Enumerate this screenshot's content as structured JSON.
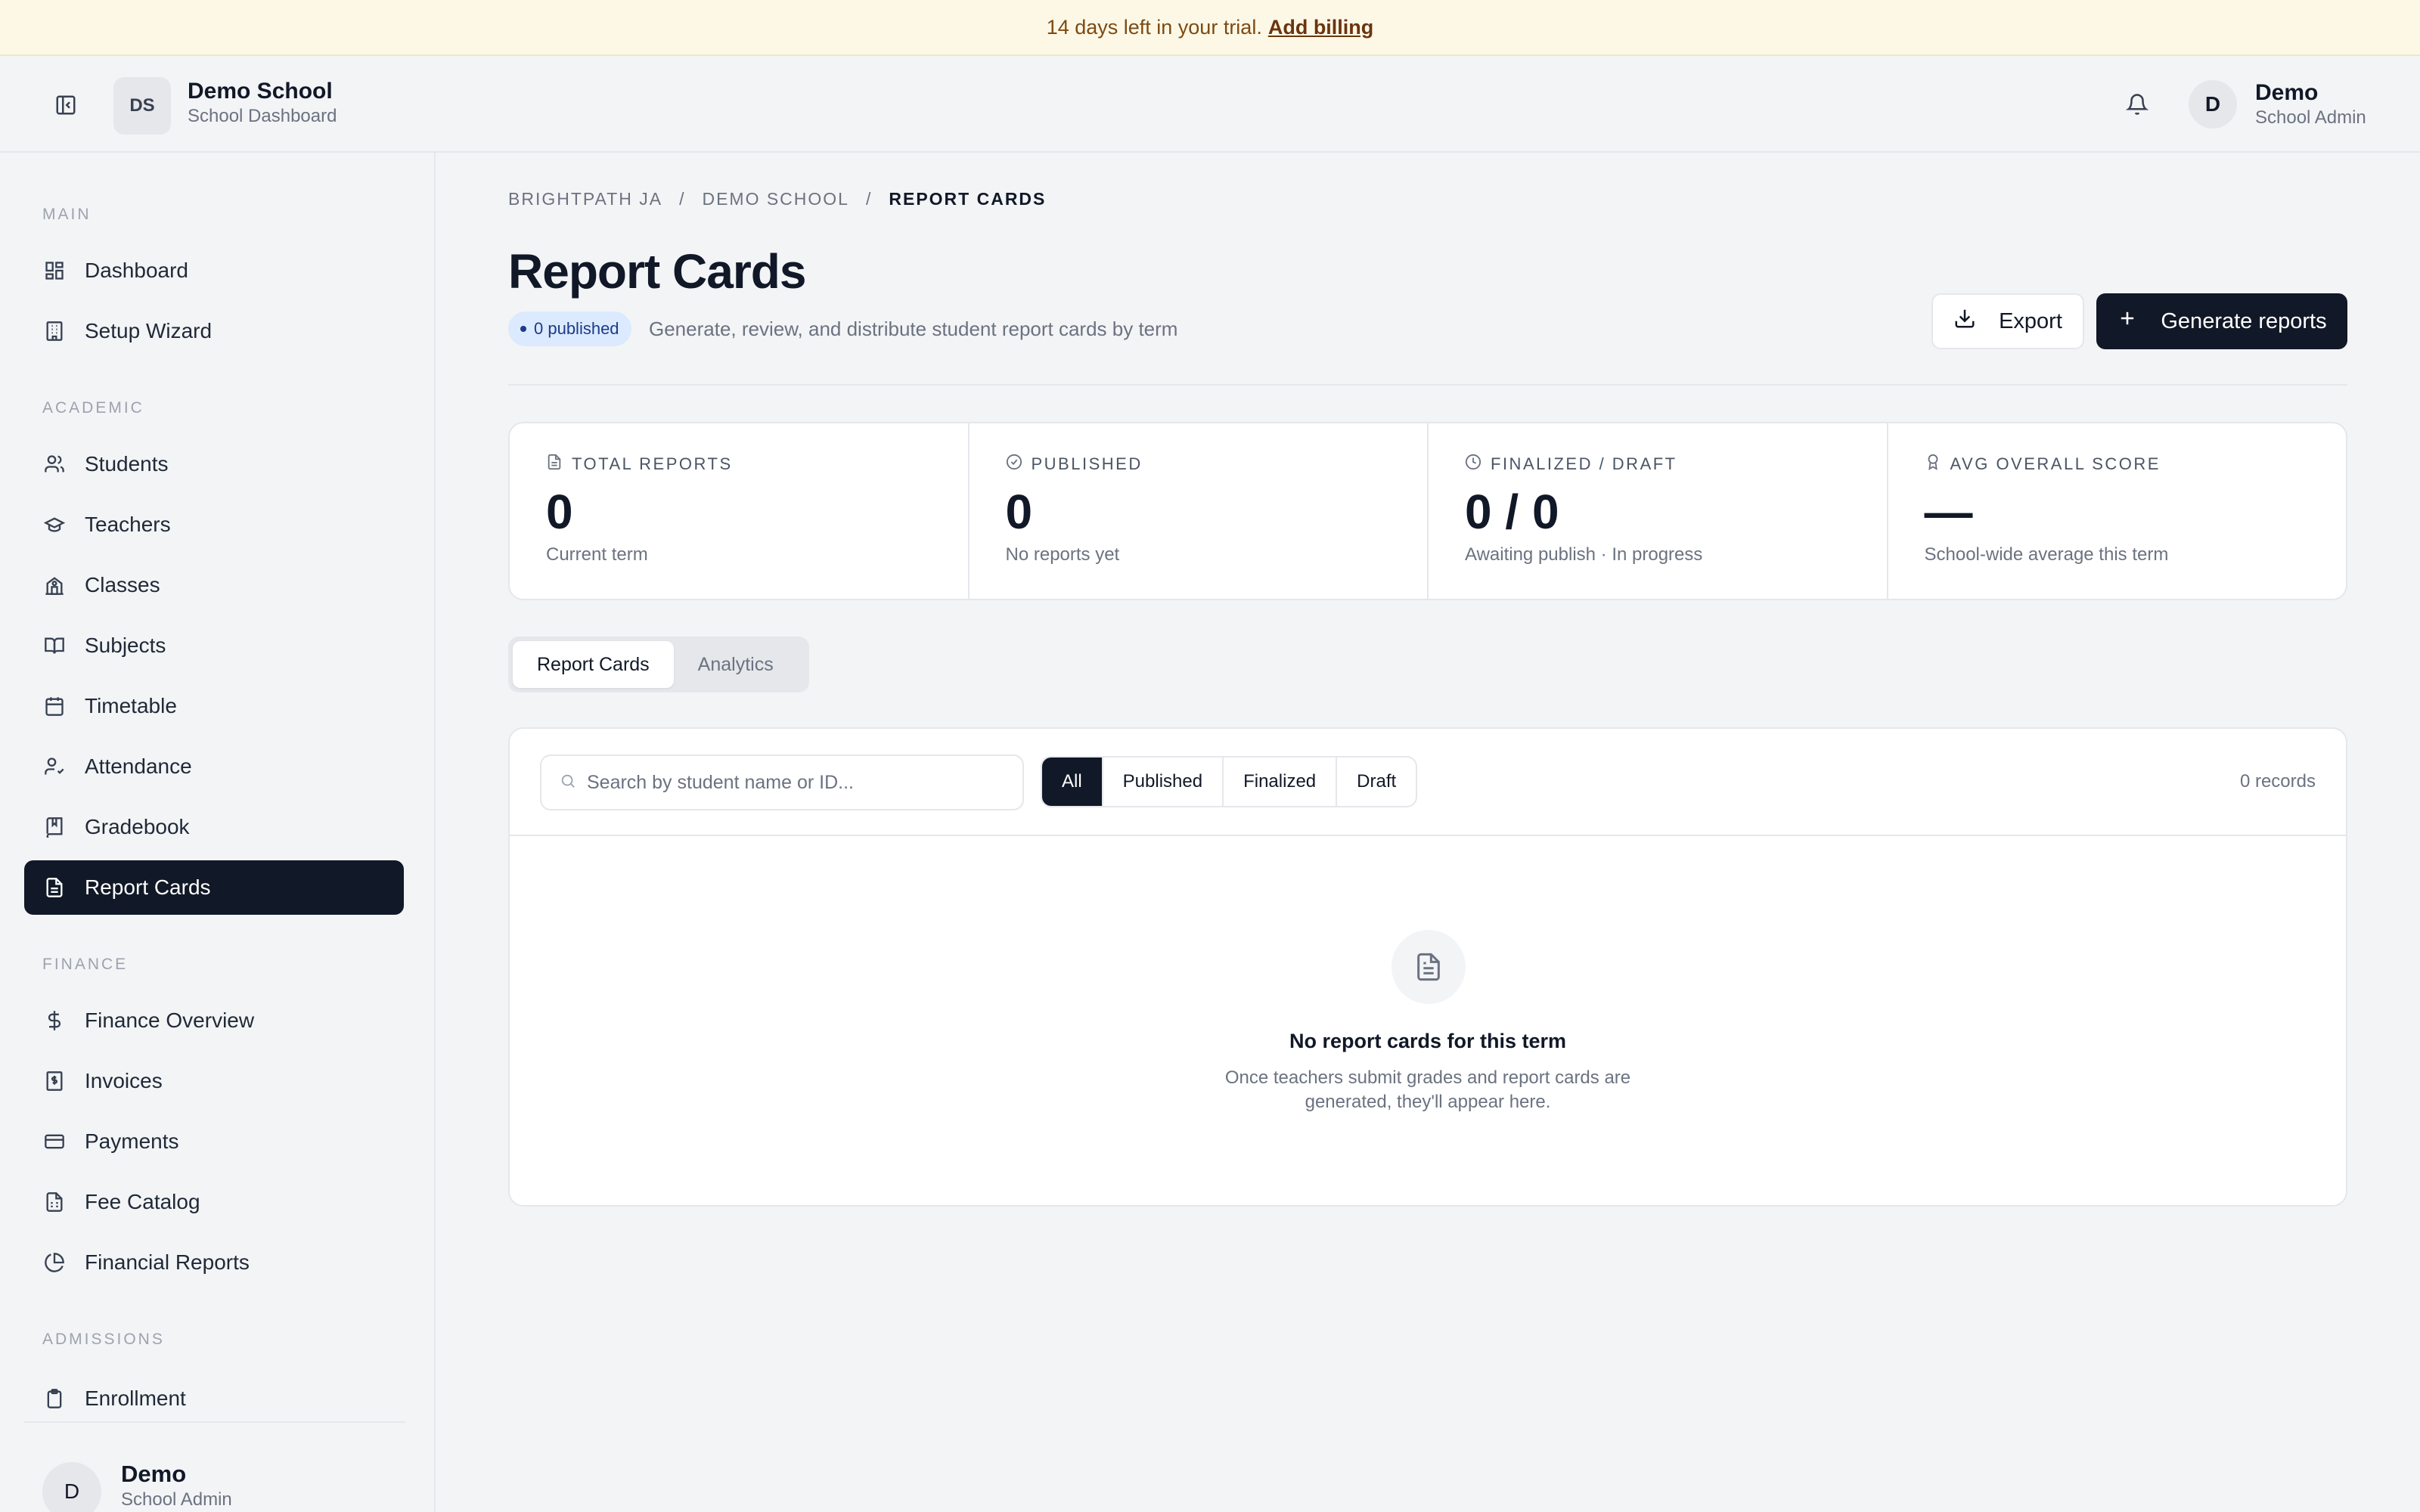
{
  "banner": {
    "text": "14 days left in your trial.",
    "link": "Add billing"
  },
  "header": {
    "school_initials": "DS",
    "school_name": "Demo School",
    "school_subtitle": "School Dashboard",
    "user_initial": "D",
    "user_name": "Demo",
    "user_role": "School Admin"
  },
  "sidebar": {
    "sections": {
      "main": "MAIN",
      "academic": "ACADEMIC",
      "finance": "FINANCE",
      "admissions": "ADMISSIONS"
    },
    "items": {
      "dashboard": "Dashboard",
      "setup_wizard": "Setup Wizard",
      "students": "Students",
      "teachers": "Teachers",
      "classes": "Classes",
      "subjects": "Subjects",
      "timetable": "Timetable",
      "attendance": "Attendance",
      "gradebook": "Gradebook",
      "report_cards": "Report Cards",
      "finance_overview": "Finance Overview",
      "invoices": "Invoices",
      "payments": "Payments",
      "fee_catalog": "Fee Catalog",
      "financial_reports": "Financial Reports",
      "enrollment": "Enrollment"
    },
    "active": "Report Cards",
    "footer": {
      "initial": "D",
      "name": "Demo",
      "role": "School Admin"
    }
  },
  "page": {
    "breadcrumb": [
      "BRIGHTPATH JA",
      "DEMO SCHOOL",
      "REPORT CARDS"
    ],
    "title": "Report Cards",
    "badge": "0 published",
    "subtitle": "Generate, review, and distribute student report cards by term",
    "export_label": "Export",
    "generate_label": "Generate reports"
  },
  "stats": [
    {
      "label": "TOTAL REPORTS",
      "value": "0",
      "note": "Current term"
    },
    {
      "label": "PUBLISHED",
      "value": "0",
      "note": "No reports yet"
    },
    {
      "label": "FINALIZED / DRAFT",
      "value": "0 / 0",
      "note": "Awaiting publish · In progress"
    },
    {
      "label": "AVG OVERALL SCORE",
      "value": "—",
      "note": "School-wide average this term"
    }
  ],
  "tabs": [
    "Report Cards",
    "Analytics"
  ],
  "toolbar": {
    "search_placeholder": "Search by student name or ID...",
    "filters": [
      "All",
      "Published",
      "Finalized",
      "Draft"
    ],
    "records": "0 records"
  },
  "empty_state": {
    "title": "No report cards for this term",
    "description": "Once teachers submit grades and report cards are generated, they'll appear here."
  }
}
